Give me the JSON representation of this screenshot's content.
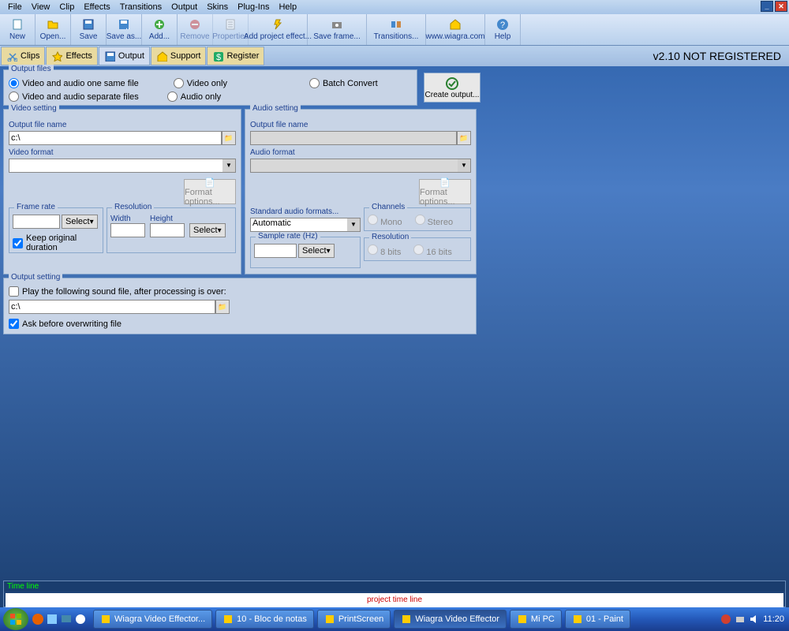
{
  "menu": [
    "File",
    "View",
    "Clip",
    "Effects",
    "Transitions",
    "Output",
    "Skins",
    "Plug-Ins",
    "Help"
  ],
  "toolbar": [
    {
      "label": "New",
      "icon": "file-new"
    },
    {
      "label": "Open...",
      "icon": "folder-open"
    },
    {
      "label": "Save",
      "icon": "disk"
    },
    {
      "label": "Save as...",
      "icon": "disk-as"
    },
    {
      "label": "Add...",
      "icon": "plus"
    },
    {
      "label": "Remove",
      "icon": "minus",
      "disabled": true
    },
    {
      "label": "Properties",
      "icon": "props",
      "disabled": true
    },
    {
      "label": "Add project effect...",
      "icon": "fx",
      "wide": true
    },
    {
      "label": "Save frame...",
      "icon": "camera",
      "wide": true
    },
    {
      "label": "Transitions...",
      "icon": "trans",
      "wide": true
    },
    {
      "label": "www.wiagra.com",
      "icon": "home",
      "wide": true
    },
    {
      "label": "Help",
      "icon": "help"
    }
  ],
  "tabs": [
    {
      "label": "Clips",
      "icon": "scissors"
    },
    {
      "label": "Effects",
      "icon": "star"
    },
    {
      "label": "Output",
      "icon": "disk",
      "active": true
    },
    {
      "label": "Support",
      "icon": "home"
    },
    {
      "label": "Register",
      "icon": "dollar"
    }
  ],
  "version": "v2.10 NOT REGISTERED",
  "output_files": {
    "title": "Output files",
    "opt1": "Video and audio one same file",
    "opt2": "Video and audio separate files",
    "opt3": "Video only",
    "opt4": "Audio only",
    "opt5": "Batch Convert"
  },
  "create_output": "Create output...",
  "video": {
    "title": "Video setting",
    "file_label": "Output file name",
    "file_value": "c:\\",
    "format_label": "Video format",
    "format_options": "Format options...",
    "framerate": {
      "title": "Frame rate",
      "select": "Select",
      "keep": "Keep original duration"
    },
    "resolution": {
      "title": "Resolution",
      "width": "Width",
      "height": "Height",
      "select": "Select"
    }
  },
  "audio": {
    "title": "Audio setting",
    "file_label": "Output file name",
    "format_label": "Audio format",
    "format_options": "Format options...",
    "std_label": "Standard audio formats...",
    "std_value": "Automatic",
    "sample_label": "Sample rate (Hz)",
    "select": "Select",
    "channels": {
      "title": "Channels",
      "mono": "Mono",
      "stereo": "Stereo"
    },
    "resolution": {
      "title": "Resolution",
      "r8": "8 bits",
      "r16": "16 bits"
    }
  },
  "output_setting": {
    "title": "Output setting",
    "play_sound": "Play the following sound file, after processing is over:",
    "sound_path": "c:\\",
    "ask": "Ask before overwriting file"
  },
  "timeline": {
    "title": "Time line",
    "text": "project time line"
  },
  "taskbar": {
    "tasks": [
      {
        "label": "Wiagra Video Effector..."
      },
      {
        "label": "10 - Bloc de notas"
      },
      {
        "label": "PrintScreen"
      },
      {
        "label": "Wiagra Video Effector",
        "active": true
      },
      {
        "label": "Mi PC"
      },
      {
        "label": "01 - Paint"
      }
    ],
    "clock": "11:20"
  }
}
